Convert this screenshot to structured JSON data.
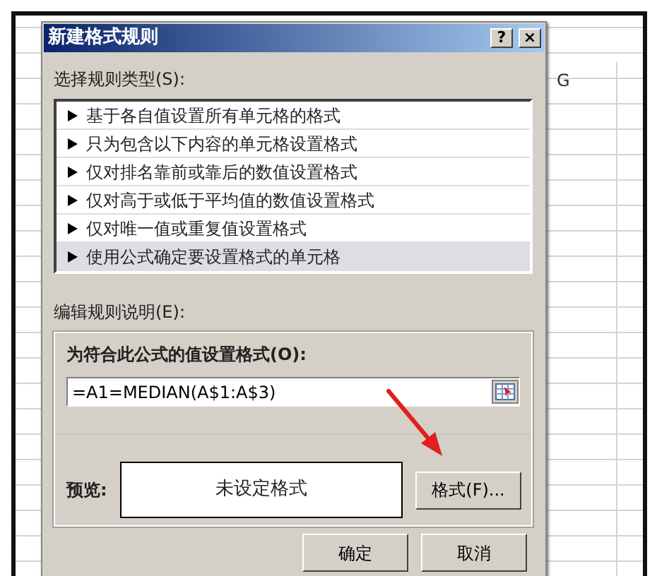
{
  "sheet": {
    "column_header": "G"
  },
  "dialog": {
    "title": "新建格式规则",
    "help_button": "?",
    "close_button": "×",
    "rule_type_label": "选择规则类型(S):",
    "rule_types": [
      {
        "label": "基于各自值设置所有单元格的格式",
        "selected": false
      },
      {
        "label": "只为包含以下内容的单元格设置格式",
        "selected": false
      },
      {
        "label": "仅对排名靠前或靠后的数值设置格式",
        "selected": false
      },
      {
        "label": "仅对高于或低于平均值的数值设置格式",
        "selected": false
      },
      {
        "label": "仅对唯一值或重复值设置格式",
        "selected": false
      },
      {
        "label": "使用公式确定要设置格式的单元格",
        "selected": true
      }
    ],
    "description_label": "编辑规则说明(E):",
    "formula_label": "为符合此公式的值设置格式(O):",
    "formula": "=A1=MEDIAN(A$1:A$3)",
    "preview_label": "预览:",
    "preview_text": "未设定格式",
    "format_button": "格式(F)...",
    "ok_button": "确定",
    "cancel_button": "取消"
  }
}
